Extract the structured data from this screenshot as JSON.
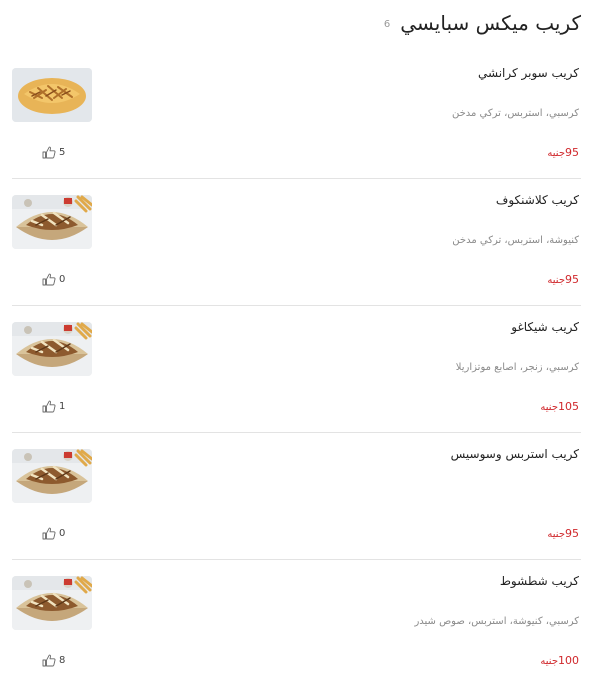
{
  "category": {
    "title": "كريب ميكس سبايسي",
    "count": "6"
  },
  "currency": "جنيه",
  "items": [
    {
      "name": "كريب سوبر كرانشي",
      "description": "كرسبي، استربس، تركي مدخن",
      "price": "95",
      "likes": "5",
      "image_style": "cheese"
    },
    {
      "name": "كريب كلاشنكوف",
      "description": "كنيوشة، استربس، تركي مدخن",
      "price": "95",
      "likes": "0",
      "image_style": "plate"
    },
    {
      "name": "كريب شيكاغو",
      "description": "كرسبي، زنجر، اصابع موتزاريلا",
      "price": "105",
      "likes": "1",
      "image_style": "plate"
    },
    {
      "name": "كريب استربس وسوسيس",
      "description": "",
      "price": "95",
      "likes": "0",
      "image_style": "plate"
    },
    {
      "name": "كريب شطشوط",
      "description": "كرسبي، كنيوشة، استربس، صوص شيدر",
      "price": "100",
      "likes": "8",
      "image_style": "plate"
    }
  ],
  "colors": {
    "price": "#d0282c",
    "description": "#8a8a8a",
    "divider": "#e3e3e3"
  },
  "icons": {
    "like": "thumbs-up-icon"
  }
}
